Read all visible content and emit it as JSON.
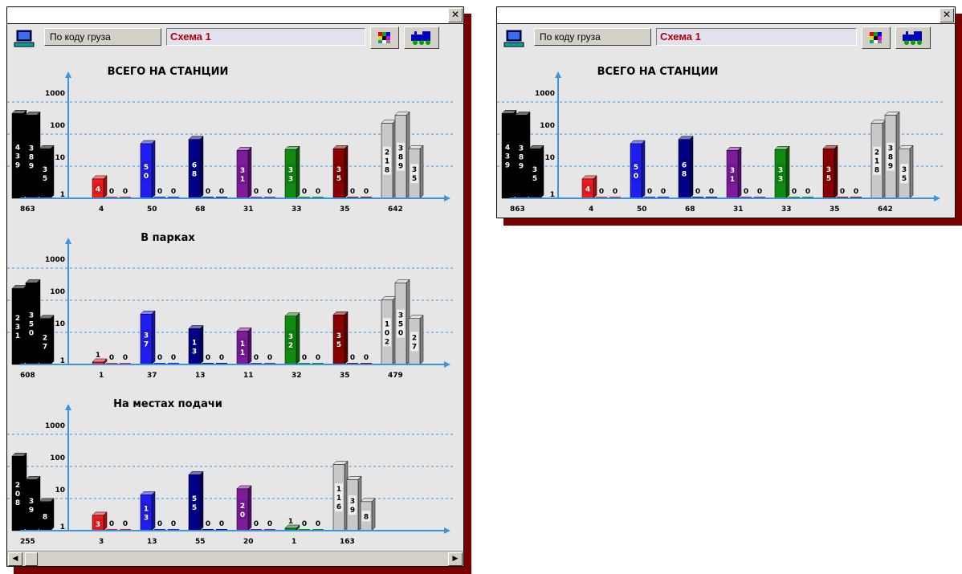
{
  "close_glyph": "✕",
  "toolbar": {
    "cargo_button_label": "По коду груза",
    "scheme_value": "Схема 1",
    "computer_icon": "computer-icon",
    "palette_icon": "color-palette-icon",
    "locomotive_icon": "locomotive-icon"
  },
  "scrollbar": {
    "left_arrow": "◀",
    "right_arrow": "▶"
  },
  "colors": {
    "black": "#000000",
    "red": "#ee1c1c",
    "blue": "#1e1ef0",
    "navy": "#000088",
    "purple": "#7e1a9c",
    "green": "#108a10",
    "darkred": "#880000",
    "gray": "#c8c8c8",
    "axis": "#3a95dd",
    "window_shadow": "#7a0000"
  },
  "chart_data": [
    {
      "type": "bar",
      "title": "ВСЕГО НА СТАНЦИИ",
      "scale": "log",
      "y_ticks": [
        "1",
        "10",
        "100",
        "1000"
      ],
      "groups": [
        {
          "color": "black",
          "bars": [
            439,
            389,
            35
          ],
          "labels": [
            "4 3 9",
            "3 8 9",
            "3 5"
          ],
          "total": "863"
        },
        {
          "color": "red",
          "bars": [
            4,
            0,
            0
          ],
          "labels": [
            "4",
            "0",
            "0"
          ],
          "total": "4"
        },
        {
          "color": "blue",
          "bars": [
            50,
            0,
            0
          ],
          "labels": [
            "5 0",
            "0",
            "0"
          ],
          "total": "50"
        },
        {
          "color": "navy",
          "bars": [
            68,
            0,
            0
          ],
          "labels": [
            "6 8",
            "0",
            "0"
          ],
          "total": "68"
        },
        {
          "color": "purple",
          "bars": [
            31,
            0,
            0
          ],
          "labels": [
            "3 1",
            "0",
            "0"
          ],
          "total": "31"
        },
        {
          "color": "green",
          "bars": [
            33,
            0,
            0
          ],
          "labels": [
            "3 3",
            "0",
            "0"
          ],
          "total": "33"
        },
        {
          "color": "darkred",
          "bars": [
            35,
            0,
            0
          ],
          "labels": [
            "3 5",
            "0",
            "0"
          ],
          "total": "35"
        },
        {
          "color": "gray",
          "bars": [
            218,
            389,
            35
          ],
          "labels": [
            "2 1 8",
            "3 8 9",
            "3 5"
          ],
          "total": "642"
        }
      ]
    },
    {
      "type": "bar",
      "title": "В парках",
      "scale": "log",
      "y_ticks": [
        "1",
        "10",
        "100",
        "1000"
      ],
      "groups": [
        {
          "color": "black",
          "bars": [
            231,
            350,
            27
          ],
          "labels": [
            "2 3 1",
            "3 5 0",
            "2 7"
          ],
          "total": "608"
        },
        {
          "color": "red",
          "bars": [
            1,
            0,
            0
          ],
          "labels": [
            "1",
            "0",
            "0"
          ],
          "total": "1"
        },
        {
          "color": "blue",
          "bars": [
            37,
            0,
            0
          ],
          "labels": [
            "3 7",
            "0",
            "0"
          ],
          "total": "37"
        },
        {
          "color": "navy",
          "bars": [
            13,
            0,
            0
          ],
          "labels": [
            "1 3",
            "0",
            "0"
          ],
          "total": "13"
        },
        {
          "color": "purple",
          "bars": [
            11,
            0,
            0
          ],
          "labels": [
            "1 1",
            "0",
            "0"
          ],
          "total": "11"
        },
        {
          "color": "green",
          "bars": [
            32,
            0,
            0
          ],
          "labels": [
            "3 2",
            "0",
            "0"
          ],
          "total": "32"
        },
        {
          "color": "darkred",
          "bars": [
            35,
            0,
            0
          ],
          "labels": [
            "3 5",
            "0",
            "0"
          ],
          "total": "35"
        },
        {
          "color": "gray",
          "bars": [
            102,
            350,
            27
          ],
          "labels": [
            "1 0 2",
            "3 5 0",
            "2 7"
          ],
          "total": "479"
        }
      ]
    },
    {
      "type": "bar",
      "title": "На местах подачи",
      "scale": "log",
      "y_ticks": [
        "1",
        "10",
        "100",
        "1000"
      ],
      "groups": [
        {
          "color": "black",
          "bars": [
            208,
            39,
            8
          ],
          "labels": [
            "2 0 8",
            "3 9",
            "8"
          ],
          "total": "255"
        },
        {
          "color": "red",
          "bars": [
            3,
            0,
            0
          ],
          "labels": [
            "3",
            "0",
            "0"
          ],
          "total": "3"
        },
        {
          "color": "blue",
          "bars": [
            13,
            0,
            0
          ],
          "labels": [
            "1 3",
            "0",
            "0"
          ],
          "total": "13"
        },
        {
          "color": "navy",
          "bars": [
            55,
            0,
            0
          ],
          "labels": [
            "5 5",
            "0",
            "0"
          ],
          "total": "55"
        },
        {
          "color": "purple",
          "bars": [
            20,
            0,
            0
          ],
          "labels": [
            "2 0",
            "0",
            "0"
          ],
          "total": "20"
        },
        {
          "color": "green",
          "bars": [
            1,
            0,
            0
          ],
          "labels": [
            "1",
            "0",
            "0"
          ],
          "total": "1"
        },
        {
          "color": "gray",
          "bars": [
            116,
            39,
            8
          ],
          "labels": [
            "1 1 6",
            "3 9",
            "8"
          ],
          "total": "163"
        }
      ]
    },
    {
      "type": "bar",
      "title": "ВСЕГО НА СТАНЦИИ",
      "scale": "log",
      "y_ticks": [
        "1",
        "10",
        "100",
        "1000"
      ],
      "groups": [
        {
          "color": "black",
          "bars": [
            439,
            389,
            35
          ],
          "labels": [
            "4 3 9",
            "3 8 9",
            "3 5"
          ],
          "total": "863"
        },
        {
          "color": "red",
          "bars": [
            4,
            0,
            0
          ],
          "labels": [
            "4",
            "0",
            "0"
          ],
          "total": "4"
        },
        {
          "color": "blue",
          "bars": [
            50,
            0,
            0
          ],
          "labels": [
            "5 0",
            "0",
            "0"
          ],
          "total": "50"
        },
        {
          "color": "navy",
          "bars": [
            68,
            0,
            0
          ],
          "labels": [
            "6 8",
            "0",
            "0"
          ],
          "total": "68"
        },
        {
          "color": "purple",
          "bars": [
            31,
            0,
            0
          ],
          "labels": [
            "3 1",
            "0",
            "0"
          ],
          "total": "31"
        },
        {
          "color": "green",
          "bars": [
            33,
            0,
            0
          ],
          "labels": [
            "3 3",
            "0",
            "0"
          ],
          "total": "33"
        },
        {
          "color": "darkred",
          "bars": [
            35,
            0,
            0
          ],
          "labels": [
            "3 5",
            "0",
            "0"
          ],
          "total": "35"
        },
        {
          "color": "gray",
          "bars": [
            218,
            389,
            35
          ],
          "labels": [
            "2 1 8",
            "3 8 9",
            "3 5"
          ],
          "total": "642"
        }
      ]
    }
  ]
}
